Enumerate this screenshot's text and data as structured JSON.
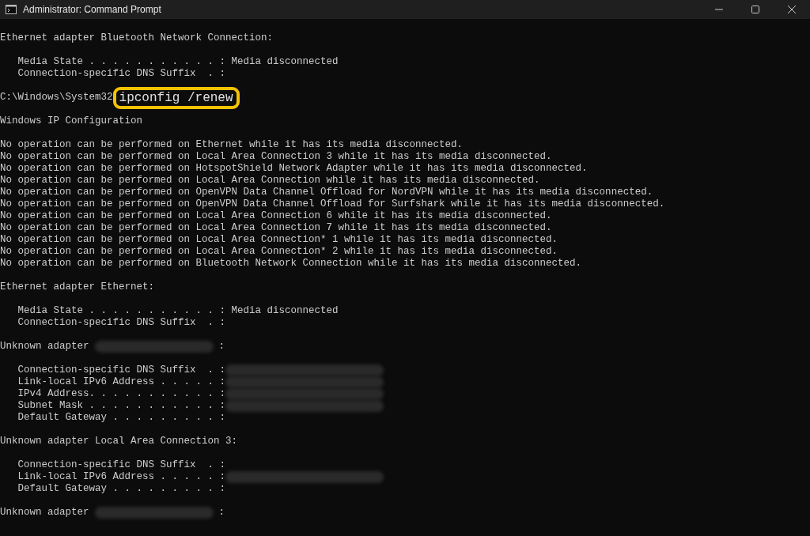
{
  "window": {
    "title": "Administrator: Command Prompt"
  },
  "console": {
    "lines": [
      {
        "kind": "text",
        "text": "Ethernet adapter Bluetooth Network Connection:"
      },
      {
        "kind": "blank"
      },
      {
        "kind": "text",
        "text": "   Media State . . . . . . . . . . . : Media disconnected"
      },
      {
        "kind": "text",
        "text": "   Connection-specific DNS Suffix  . :"
      },
      {
        "kind": "blank"
      },
      {
        "kind": "prompt",
        "text": "C:\\Windows\\System32",
        "command": "ipconfig /renew",
        "highlighted": true
      },
      {
        "kind": "blank"
      },
      {
        "kind": "text",
        "text": "Windows IP Configuration"
      },
      {
        "kind": "blank"
      },
      {
        "kind": "text",
        "text": "No operation can be performed on Ethernet while it has its media disconnected."
      },
      {
        "kind": "text",
        "text": "No operation can be performed on Local Area Connection 3 while it has its media disconnected."
      },
      {
        "kind": "text",
        "text": "No operation can be performed on HotspotShield Network Adapter while it has its media disconnected."
      },
      {
        "kind": "text",
        "text": "No operation can be performed on Local Area Connection while it has its media disconnected."
      },
      {
        "kind": "text",
        "text": "No operation can be performed on OpenVPN Data Channel Offload for NordVPN while it has its media disconnected."
      },
      {
        "kind": "text",
        "text": "No operation can be performed on OpenVPN Data Channel Offload for Surfshark while it has its media disconnected."
      },
      {
        "kind": "text",
        "text": "No operation can be performed on Local Area Connection 6 while it has its media disconnected."
      },
      {
        "kind": "text",
        "text": "No operation can be performed on Local Area Connection 7 while it has its media disconnected."
      },
      {
        "kind": "text",
        "text": "No operation can be performed on Local Area Connection* 1 while it has its media disconnected."
      },
      {
        "kind": "text",
        "text": "No operation can be performed on Local Area Connection* 2 while it has its media disconnected."
      },
      {
        "kind": "text",
        "text": "No operation can be performed on Bluetooth Network Connection while it has its media disconnected."
      },
      {
        "kind": "blank"
      },
      {
        "kind": "text",
        "text": "Ethernet adapter Ethernet:"
      },
      {
        "kind": "blank"
      },
      {
        "kind": "text",
        "text": "   Media State . . . . . . . . . . . : Media disconnected"
      },
      {
        "kind": "text",
        "text": "   Connection-specific DNS Suffix  . :"
      },
      {
        "kind": "blank"
      },
      {
        "kind": "redacted",
        "text": "Unknown adapter",
        "suffix": ":"
      },
      {
        "kind": "blank"
      },
      {
        "kind": "redacted",
        "text": "   Connection-specific DNS Suffix  . :"
      },
      {
        "kind": "redacted",
        "text": "   Link-local IPv6 Address . . . . . :"
      },
      {
        "kind": "redacted",
        "text": "   IPv4 Address. . . . . . . . . . . :"
      },
      {
        "kind": "redacted",
        "text": "   Subnet Mask . . . . . . . . . . . :"
      },
      {
        "kind": "text",
        "text": "   Default Gateway . . . . . . . . . :"
      },
      {
        "kind": "blank"
      },
      {
        "kind": "text",
        "text": "Unknown adapter Local Area Connection 3:"
      },
      {
        "kind": "blank"
      },
      {
        "kind": "text",
        "text": "   Connection-specific DNS Suffix  . :"
      },
      {
        "kind": "redacted",
        "text": "   Link-local IPv6 Address . . . . . :"
      },
      {
        "kind": "text",
        "text": "   Default Gateway . . . . . . . . . :"
      },
      {
        "kind": "blank"
      },
      {
        "kind": "redacted",
        "text": "Unknown adapter",
        "suffix": ":"
      }
    ]
  }
}
